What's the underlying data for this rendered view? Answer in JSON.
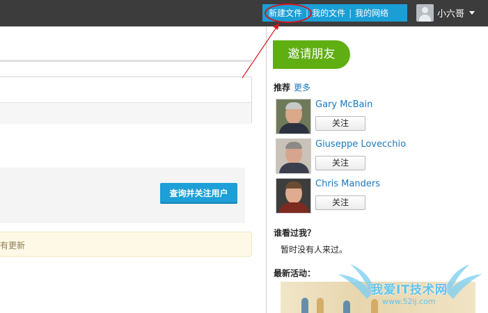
{
  "topbar": {
    "nav_new_file": "新建文件",
    "nav_sep": "|",
    "nav_my_files": "我的文件",
    "nav_my_network": "我的网络",
    "user_name": "小六哥"
  },
  "main": {
    "query_button": "查询并关注用户",
    "notice_text": "有更新"
  },
  "sidebar": {
    "invite_button": "邀请朋友",
    "recommend_title": "推荐",
    "more_link": "更多",
    "recommendations": [
      {
        "name": "Gary McBain",
        "follow": "关注"
      },
      {
        "name": "Giuseppe Lovecchio",
        "follow": "关注"
      },
      {
        "name": "Chris Manders",
        "follow": "关注"
      }
    ],
    "visitors_title": "谁看过我？",
    "visitors_text": "暂时没有人来过。",
    "activity_title": "最新活动："
  },
  "watermark": {
    "text": "我爱IT技术网",
    "url": "www.52ij.com"
  },
  "colors": {
    "topbar": "#3c3c3c",
    "nav_blue": "#1a9ed6",
    "invite_green": "#5fae12",
    "link_blue": "#1a78c2",
    "annotation_red": "#d8151b"
  }
}
